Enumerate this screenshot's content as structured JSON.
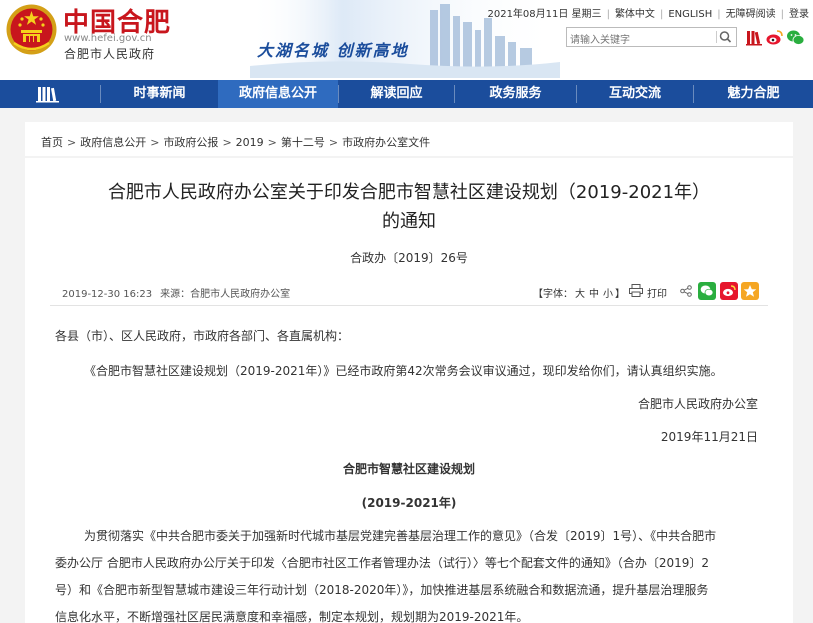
{
  "header": {
    "logo_title": "中国合肥",
    "logo_url": "www.hefei.gov.cn",
    "logo_sub": "合肥市人民政府",
    "slogan": "大湖名城  创新高地",
    "date": "2021年08月11日 星期三",
    "lang_simplified": "繁体中文",
    "lang_english": "ENGLISH",
    "accessibility": "无障碍阅读",
    "login": "登录",
    "search_placeholder": "请输入关键字"
  },
  "nav": {
    "items": [
      {
        "label": "时事新闻"
      },
      {
        "label": "政府信息公开"
      },
      {
        "label": "解读回应"
      },
      {
        "label": "政务服务"
      },
      {
        "label": "互动交流"
      },
      {
        "label": "魅力合肥"
      }
    ],
    "active_index": 1
  },
  "breadcrumb": [
    "首页",
    "政府信息公开",
    "市政府公报",
    "2019",
    "第十二号",
    "市政府办公室文件"
  ],
  "article": {
    "title_line1": "合肥市人民政府办公室关于印发合肥市智慧社区建设规划（2019-2021年）",
    "title_line2": "的通知",
    "doc_number": "合政办〔2019〕26号",
    "publish_time": "2019-12-30 16:23",
    "source": "来源：合肥市人民政府办公室",
    "font_label": "【字体：",
    "font_large": "大",
    "font_medium": "中",
    "font_small": "小",
    "font_end": "】",
    "print": "打印",
    "salutation": "各县（市）、区人民政府，市政府各部门、各直属机构：",
    "body1": "《合肥市智慧社区建设规划（2019-2021年）》已经市政府第42次常务会议审议通过，现印发给你们，请认真组织实施。",
    "signer": "合肥市人民政府办公室",
    "sign_date": "2019年11月21日",
    "sub_title": "合肥市智慧社区建设规划",
    "sub_title2": "(2019-2021年)",
    "body2_line1": "为贯彻落实《中共合肥市委关于加强新时代城市基层党建完善基层治理工作的意见》（合发〔2019〕1号）、《中共合肥市",
    "body2_line2": "委办公厅 合肥市人民政府办公厅关于印发〈合肥市社区工作者管理办法（试行）〉等七个配套文件的通知》（合办〔2019〕2",
    "body2_line3": "号）和《合肥市新型智慧城市建设三年行动计划（2018-2020年）》，加快推进基层系统融合和数据流通，提升基层治理服务",
    "body2_line4": "信息化水平，不断增强社区居民满意度和幸福感，制定本规划，规划期为2019-2021年。"
  },
  "colors": {
    "brand_red": "#c8161d",
    "nav_blue": "#1b4d9c",
    "nav_active": "#2f6bbf",
    "wechat_green": "#2aae3f",
    "weibo_red": "#e6162d",
    "favorite_orange": "#f5a623"
  },
  "icons": [
    "national-emblem-icon",
    "search-icon",
    "weibo-icon",
    "wechat-icon",
    "library-icon",
    "print-icon",
    "share-icon",
    "wechat-icon",
    "weibo-icon",
    "star-icon"
  ]
}
